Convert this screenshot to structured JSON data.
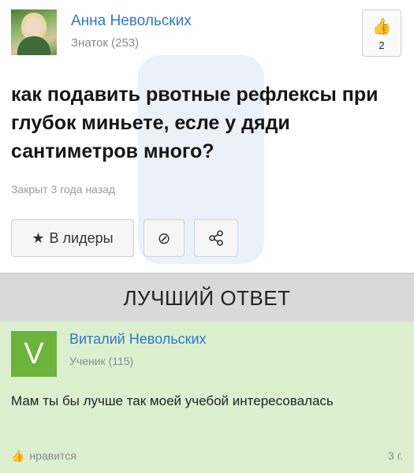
{
  "question": {
    "author_name": "Анна Невольских",
    "author_rank": "Знаток (253)",
    "likes": "2",
    "text": "как подавить рвотные рефлексы при глубок миньете, есле у дяди сантиметров много?",
    "status": "Закрыт 3 года назад",
    "actions": {
      "leaders_label": "В лидеры",
      "leaders_icon": "star-icon",
      "block_icon": "block-icon",
      "share_icon": "share-icon"
    }
  },
  "best_answer": {
    "header": "ЛУЧШИЙ ОТВЕТ",
    "avatar_letter": "V",
    "author_name": "Виталий Невольских",
    "author_rank": "Ученик (115)",
    "text": "Мам ты бы лучше так моей учебой интересовалась",
    "like_label": "нравится",
    "time": "3 г."
  },
  "colors": {
    "link": "#2f78c6",
    "answer_bg": "#dcf0d0",
    "answer_avatar": "#6bb33a",
    "header_bg": "#d9d9d9"
  }
}
